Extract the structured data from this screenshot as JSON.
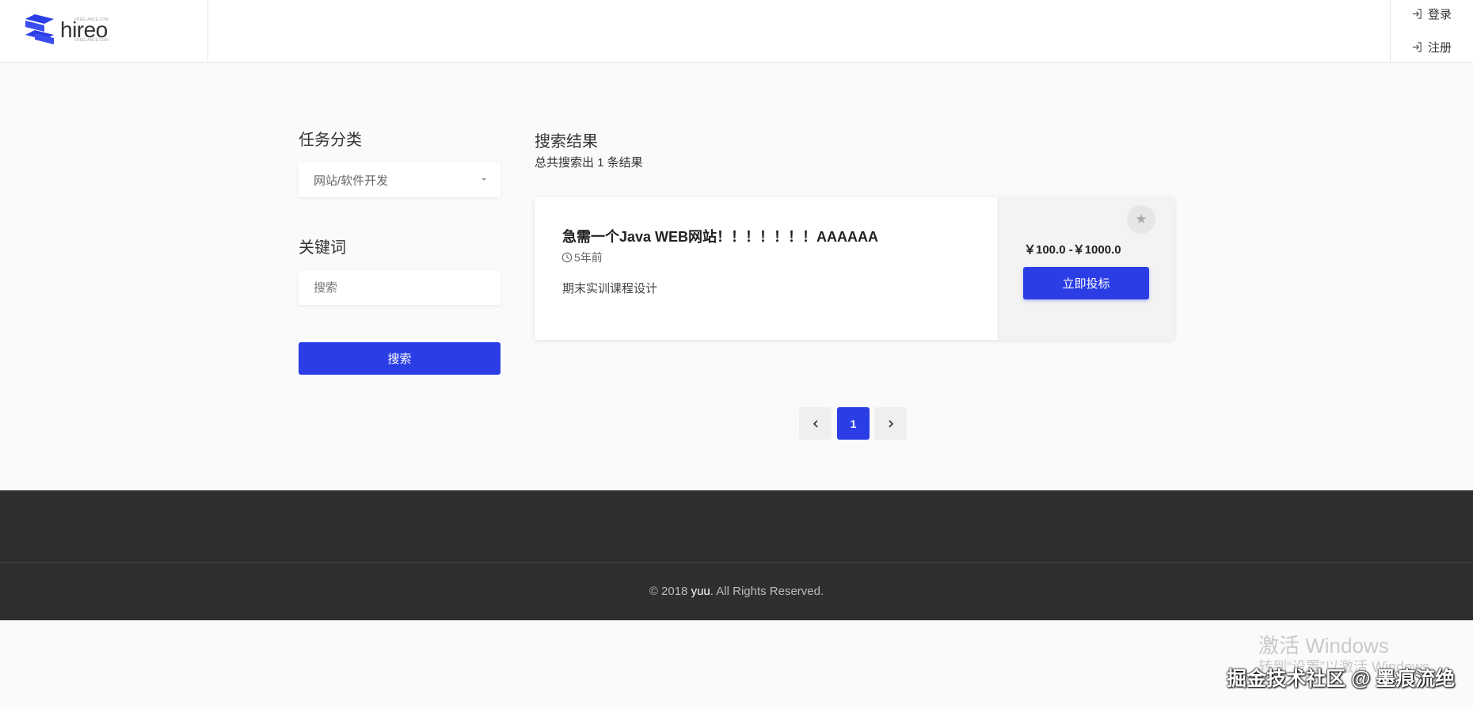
{
  "header": {
    "logo_text": "hireo",
    "logo_tagline_top": "FREELANCE.COM",
    "logo_tagline_bottom": "FREELANCE.COM",
    "login_label": "登录",
    "register_label": "注册"
  },
  "sidebar": {
    "category_title": "任务分类",
    "category_value": "网站/软件开发",
    "keyword_title": "关键词",
    "keyword_placeholder": "搜索",
    "search_button": "搜索"
  },
  "results": {
    "title": "搜索结果",
    "count_text": "总共搜索出 1 条结果",
    "items": [
      {
        "title": "急需一个Java WEB网站！！！！！！！AAAAAA",
        "time": "5年前",
        "description": "期末实训课程设计",
        "price": "￥100.0 -￥1000.0",
        "bid_button": "立即投标",
        "bookmark_icon": "star-icon"
      }
    ]
  },
  "pagination": {
    "current": "1",
    "prev_icon": "chevron-left-icon",
    "next_icon": "chevron-right-icon"
  },
  "footer": {
    "copyright_prefix": "© 2018 ",
    "copyright_name": "yuu",
    "copyright_suffix": ". All Rights Reserved."
  },
  "overlay": {
    "activate_title": "激活 Windows",
    "activate_sub": "转到“设置”以激活 Windows。",
    "watermark": "掘金技术社区 @ 墨痕流绝"
  },
  "colors": {
    "accent": "#2b3ee6",
    "footer_bg": "#2f2f2f",
    "page_bg": "#fafafa"
  }
}
